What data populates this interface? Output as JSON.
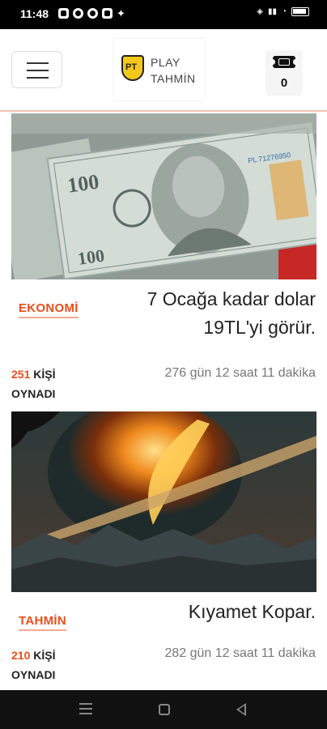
{
  "status_bar": {
    "time": "11:48",
    "icons": [
      "messages-icon",
      "a-icon",
      "clock-icon",
      "shield-icon",
      "twitter-icon"
    ],
    "battery_label": "80"
  },
  "header": {
    "logo_badge": "PT",
    "logo_line1": "PLAY",
    "logo_line2": "TAHMİN",
    "ticket_count": "0"
  },
  "cards": [
    {
      "category": "EKONOMİ",
      "title": "7 Ocağa kadar dolar 19TL'yi görür.",
      "players_count": "251",
      "players_label_1": "KİŞİ",
      "players_label_2": "OYNADI",
      "remaining": "276 gün 12 saat 11 dakika"
    },
    {
      "category": "TAHMİN",
      "title": "Kıyamet Kopar.",
      "players_count": "210",
      "players_label_1": "KİŞİ",
      "players_label_2": "OYNADI",
      "remaining": "282 gün 12 saat 11 dakika"
    }
  ],
  "colors": {
    "accent": "#e94e1b",
    "logo_yellow": "#f3c81a"
  }
}
